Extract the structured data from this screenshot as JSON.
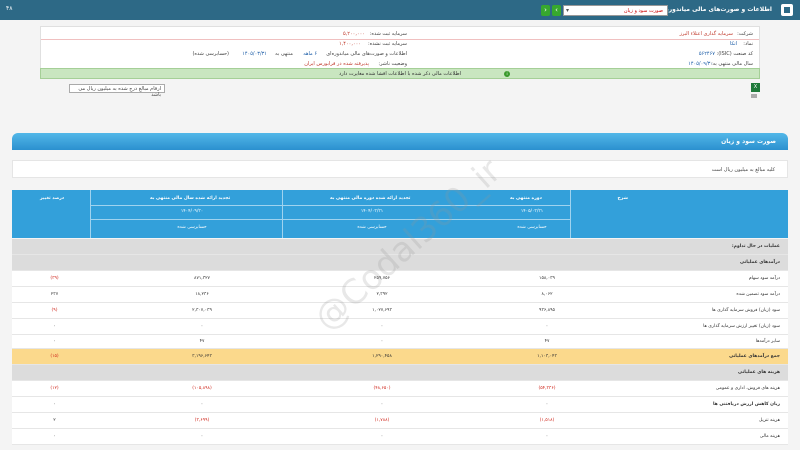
{
  "topbar": {
    "title": "اطلاعات و صورت‌های مالی میاندوره‌ای",
    "statement_select": "صورت سود و زیان",
    "version_label": "۴۸"
  },
  "info": {
    "company_label": "شرکت:",
    "company_value": "سرمایه گذاری اعتلاء البرز",
    "symbol_label": "نماد:",
    "symbol_value": "اتکا",
    "isic_label": "کد صنعت (ISIC):",
    "isic_value": "۵۶۲۴۶۷",
    "fiscal_label": "سال مالی منتهی به:",
    "fiscal_value": "۱۴۰۵/۰۹/۳۰",
    "cap_reg_label": "سرمایه ثبت شده:",
    "cap_reg_value": "۵,۲۰۰,۰۰۰",
    "cap_unreg_label": "سرمایه ثبت نشده:",
    "cap_unreg_value": "۱,۴۰۰,۰۰۰",
    "period_text": "اطلاعات و صورت‌های مالی میاندوره‌ای",
    "period_months": "۶ ماهه",
    "period_end_label": "منتهی به",
    "period_end_value": "۱۴۰۵/۰۳/۳۱",
    "audit_text": "(حسابرسی شده)",
    "status_label": "وضعیت ناشر:",
    "status_value": "پذیرفته شده در فرابورس ایران",
    "notice": "اطلاعات مالی ذکر شده با اطلاعات افشا شده مغایرت دارد"
  },
  "unit_box": "ارقام مبالغ درج شده به میلیون ریال می باشد",
  "section": {
    "title": "صورت سود و زیان",
    "subtitle": "کلیه مبالغ به میلیون ریال است"
  },
  "table_head": {
    "desc": "شرح",
    "col1": "دوره منتهی به",
    "col2": "تجدید ارائه شده دوره مالی منتهی به",
    "col3": "تجدید ارائه شده سال مالی منتهی به",
    "col4": "درصد تغییر",
    "date1": "۱۴۰۵/۰۳/۳۱",
    "date2": "۱۴۰۴/۰۳/۳۱",
    "date3": "۱۴۰۴/۰۹/۳۰",
    "audit1": "حسابرسی شده",
    "audit2": "حسابرسی شده",
    "audit3": "حسابرسی شده"
  },
  "rows": [
    {
      "label": "عملیات در حال تداوم:",
      "v1": "",
      "v2": "",
      "v3": "",
      "v4": "",
      "style": "gray",
      "bold": true
    },
    {
      "label": "درآمدهای عملیاتی",
      "v1": "",
      "v2": "",
      "v3": "",
      "v4": "",
      "style": "gray",
      "bold": true
    },
    {
      "label": "درآمد سود سهام",
      "v1": "۱۵۸,۰۳۹",
      "v2": "۲۵۹,۷۵۶",
      "v3": "۸۷۱,۳۲۷",
      "v4": "(۳۹)",
      "style": "white",
      "bold": false,
      "neg4": true
    },
    {
      "label": "درآمد سود تضمین شده",
      "v1": "۸,۰۶۲",
      "v2": "۲,۳۹۲",
      "v3": "۱۸,۲۳۶",
      "v4": "۲۳۷",
      "style": "white",
      "bold": false
    },
    {
      "label": "سود (زیان) فروش سرمایه گذاری ها",
      "v1": "۹۳۶,۸۹۵",
      "v2": "۱,۰۲۷,۶۹۳",
      "v3": "۲,۳۰۷,۰۳۹",
      "v4": "(۹)",
      "style": "white",
      "bold": false,
      "neg4": true
    },
    {
      "label": "سود (زیان) تغییر ارزش سرمایه گذاری ها",
      "v1": "۰",
      "v2": "۰",
      "v3": "۰",
      "v4": "۰",
      "style": "white",
      "bold": false
    },
    {
      "label": "سایر درآمدها",
      "v1": "۴۷",
      "v2": "۰",
      "v3": "۴۷",
      "v4": "۰",
      "style": "white",
      "bold": false
    },
    {
      "label": "جمع درآمدهای عملیاتی",
      "v1": "۱,۱۰۳,۰۴۳",
      "v2": "۱,۲۹۰,۴۵۸",
      "v3": "۳,۱۹۶,۶۴۳",
      "v4": "(۱۵)",
      "style": "yellow",
      "bold": true,
      "neg4": true
    },
    {
      "label": "هزینه های عملیاتی",
      "v1": "",
      "v2": "",
      "v3": "",
      "v4": "",
      "style": "gray",
      "bold": true
    },
    {
      "label": "هزینه های فروش، اداری و عمومی",
      "v1": "(۵۴,۳۳۶)",
      "v2": "(۴۸,۶۵۰)",
      "v3": "(۱۰۵,۸۹۸)",
      "v4": "(۱۲)",
      "style": "white",
      "bold": false,
      "neg1": true,
      "neg2": true,
      "neg3": true,
      "neg4": true
    },
    {
      "label": "زیان کاهش ارزش دریافتنی ها",
      "v1": "۰",
      "v2": "۰",
      "v3": "۰",
      "v4": "۰",
      "style": "white",
      "bold": true
    },
    {
      "label": "هزینه تنزیل",
      "v1": "(۱,۵۱۸)",
      "v2": "(۱,۷۸۸)",
      "v3": "(۳,۶۹۹)",
      "v4": "۲",
      "style": "white",
      "bold": false,
      "neg1": true,
      "neg2": true,
      "neg3": true
    },
    {
      "label": "هزینه مالی",
      "v1": "۰",
      "v2": "۰",
      "v3": "۰",
      "v4": "۰",
      "style": "white",
      "bold": false
    }
  ],
  "watermark": "@Codal360_ir"
}
